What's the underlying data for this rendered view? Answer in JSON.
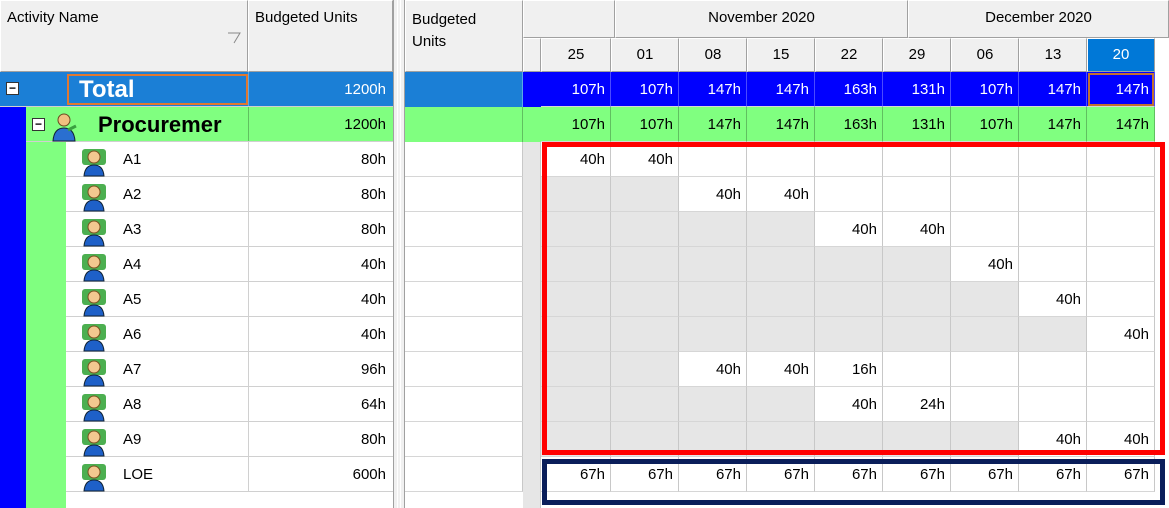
{
  "left_grid": {
    "headers": {
      "activity_name": "Activity Name",
      "budgeted_units": "Budgeted Units"
    },
    "total": {
      "label": "Total",
      "units": "1200h",
      "toggle": "−"
    },
    "wbs": {
      "label": "Procuremer",
      "units": "1200h",
      "toggle": "−"
    },
    "activities": [
      {
        "name": "A1",
        "units": "80h"
      },
      {
        "name": "A2",
        "units": "80h"
      },
      {
        "name": "A3",
        "units": "80h"
      },
      {
        "name": "A4",
        "units": "40h"
      },
      {
        "name": "A5",
        "units": "40h"
      },
      {
        "name": "A6",
        "units": "40h"
      },
      {
        "name": "A7",
        "units": "96h"
      },
      {
        "name": "A8",
        "units": "64h"
      },
      {
        "name": "A9",
        "units": "80h"
      },
      {
        "name": "LOE",
        "units": "600h"
      }
    ]
  },
  "right_grid": {
    "header": {
      "budgeted_units": "Budgeted\nUnits"
    },
    "months": [
      "November 2020",
      "December 2020"
    ],
    "weeks": [
      "25",
      "01",
      "08",
      "15",
      "22",
      "29",
      "06",
      "13",
      "20"
    ],
    "total_values": [
      "107h",
      "107h",
      "147h",
      "147h",
      "163h",
      "131h",
      "107h",
      "147h",
      "147h"
    ],
    "wbs_values": [
      "107h",
      "107h",
      "147h",
      "147h",
      "163h",
      "131h",
      "107h",
      "147h",
      "147h"
    ],
    "activity_values": [
      [
        "40h",
        "40h",
        "",
        "",
        "",
        "",
        "",
        "",
        ""
      ],
      [
        "",
        "",
        "40h",
        "40h",
        "",
        "",
        "",
        "",
        ""
      ],
      [
        "",
        "",
        "",
        "",
        "40h",
        "40h",
        "",
        "",
        ""
      ],
      [
        "",
        "",
        "",
        "",
        "",
        "",
        "40h",
        "",
        ""
      ],
      [
        "",
        "",
        "",
        "",
        "",
        "",
        "",
        "40h",
        ""
      ],
      [
        "",
        "",
        "",
        "",
        "",
        "",
        "",
        "",
        "40h"
      ],
      [
        "",
        "",
        "40h",
        "40h",
        "16h",
        "",
        "",
        "",
        ""
      ],
      [
        "",
        "",
        "",
        "",
        "40h",
        "24h",
        "",
        "",
        ""
      ],
      [
        "",
        "",
        "",
        "",
        "",
        "",
        "",
        "40h",
        "40h"
      ],
      [
        "67h",
        "67h",
        "67h",
        "67h",
        "67h",
        "67h",
        "67h",
        "67h",
        "67h"
      ]
    ],
    "shaded_before": [
      0,
      2,
      4,
      6,
      7,
      8,
      2,
      4,
      7,
      0
    ]
  },
  "colors": {
    "total_row": "#1b7fd6",
    "total_timeline": "#0000ff",
    "wbs_row": "#80ff80",
    "indent_bar": "#0000ff",
    "highlight_red": "#ff0000",
    "highlight_navy": "#0a1e5a",
    "selected_cell": "#c07030"
  }
}
